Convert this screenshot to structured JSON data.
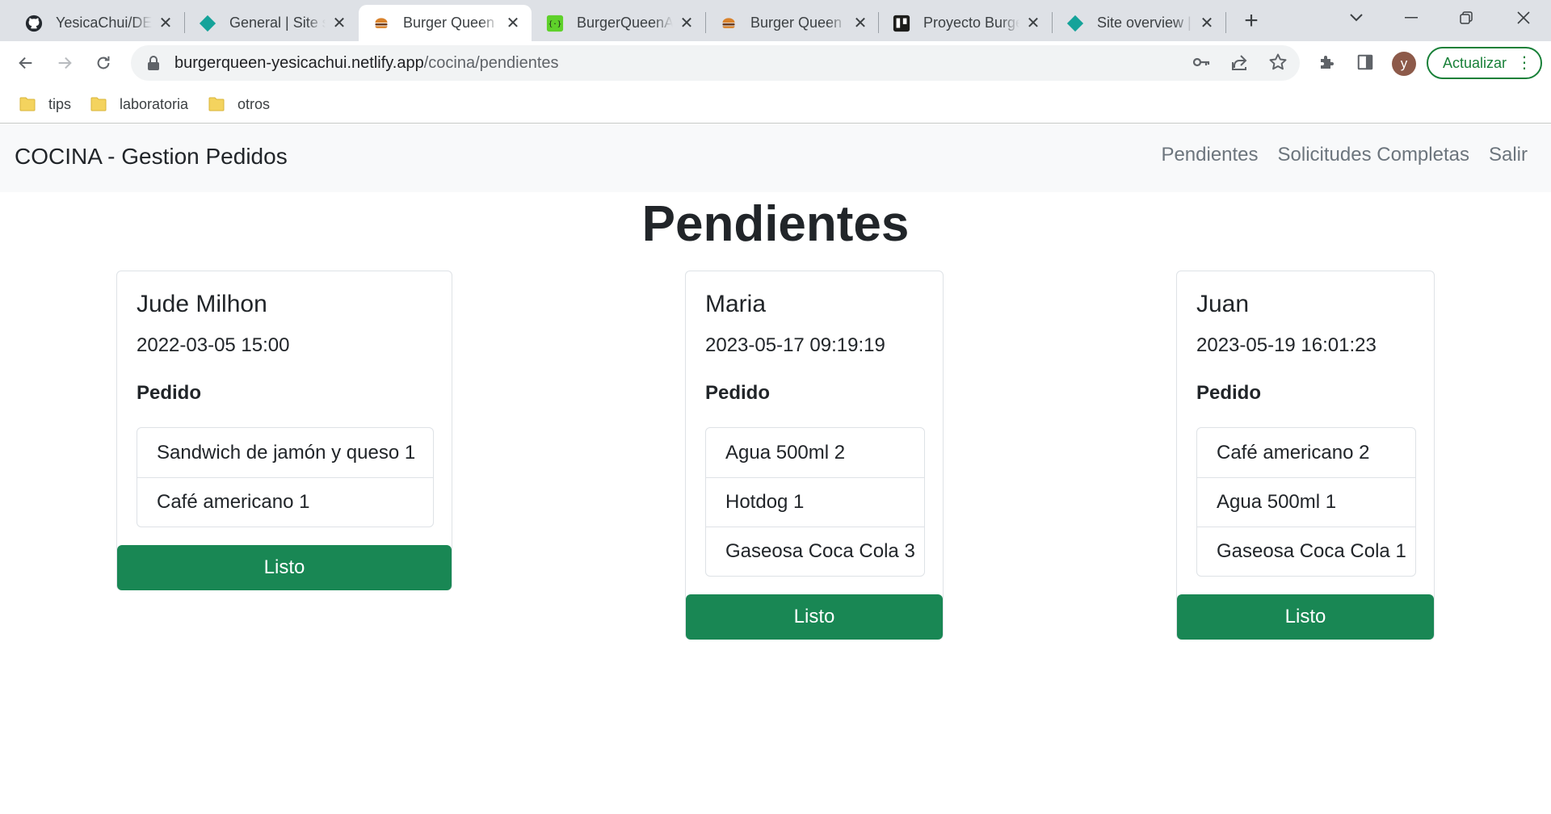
{
  "browser": {
    "tabs": [
      {
        "title": "YesicaChui/DEV",
        "icon": "github-icon"
      },
      {
        "title": "General | Site settings",
        "icon": "netlify-icon"
      },
      {
        "title": "Burger Queen",
        "icon": "burger-icon",
        "active": true
      },
      {
        "title": "BurgerQueenAPI",
        "icon": "mockapi-icon"
      },
      {
        "title": "Burger Queen",
        "icon": "burger-icon"
      },
      {
        "title": "Proyecto Burger Queen",
        "icon": "trello-icon"
      },
      {
        "title": "Site overview | Netlify",
        "icon": "netlify-icon"
      }
    ],
    "url_host": "burgerqueen-yesicachui.netlify.app",
    "url_path": "/cocina/pendientes",
    "profile_initial": "y",
    "update_label": "Actualizar",
    "bookmarks": [
      "tips",
      "laboratoria",
      "otros"
    ],
    "colors": {
      "tabstrip": "#dee1e6",
      "update_green": "#188038"
    }
  },
  "navbar": {
    "brand": "COCINA - Gestion Pedidos",
    "links": [
      "Pendientes",
      "Solicitudes Completas",
      "Salir"
    ]
  },
  "page": {
    "title": "Pendientes",
    "section_label": "Pedido",
    "ready_label": "Listo"
  },
  "orders": [
    {
      "customer": "Jude Milhon",
      "datetime": "2022-03-05 15:00",
      "items": [
        "Sandwich de jamón y queso 1",
        "Café americano 1"
      ]
    },
    {
      "customer": "Maria",
      "datetime": "2023-05-17 09:19:19",
      "items": [
        "Agua 500ml 2",
        "Hotdog 1",
        "Gaseosa Coca Cola 3"
      ]
    },
    {
      "customer": "Juan",
      "datetime": "2023-05-19 16:01:23",
      "items": [
        "Café americano 2",
        "Agua 500ml 1",
        "Gaseosa Coca Cola 1"
      ]
    }
  ],
  "colors": {
    "button_green": "#198754",
    "navbar_bg": "#f8f9fa"
  }
}
